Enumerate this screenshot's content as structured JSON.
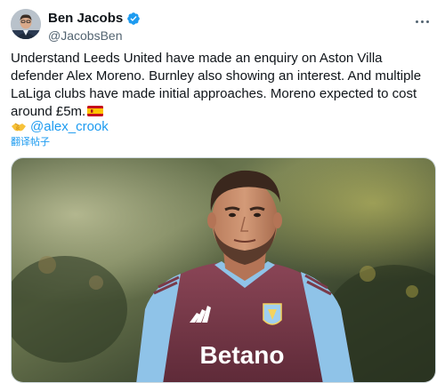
{
  "author": {
    "display_name": "Ben Jacobs",
    "handle": "@JacobsBen",
    "verified": true,
    "avatar_icon": "profile-avatar"
  },
  "tweet": {
    "text": "Understand Leeds United have made an enquiry on Aston Villa defender Alex Moreno. Burnley also showing an interest. And multiple LaLiga clubs have made initial approaches. Moreno expected to cost around £5m.",
    "flag_icon": "spain-flag-emoji",
    "mention_emoji_icon": "handshake-emoji",
    "mention": "@alex_crook",
    "translate_label": "翻译帖子"
  },
  "media": {
    "description_icon": "footballer-photo",
    "shirt_sponsor": "Betano"
  },
  "colors": {
    "link": "#1d9bf0",
    "verified": "#1d9bf0",
    "secondary_text": "#536471",
    "kit_claret": "#7a3b4a",
    "kit_sky_blue": "#8fc3e8"
  }
}
